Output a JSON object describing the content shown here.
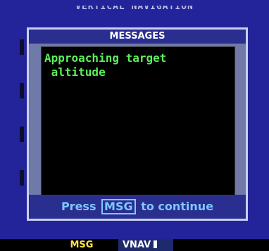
{
  "page": {
    "title": "VERTICAL NAVIGATION"
  },
  "message_window": {
    "header": "MESSAGES",
    "body": "Approaching target\n altitude",
    "footer_prefix": "Press",
    "footer_key": "MSG",
    "footer_suffix": "to continue"
  },
  "softkeys": {
    "msg": "MSG",
    "vnav": "VNAV"
  },
  "colors": {
    "screen_background": "#23239a",
    "message_text": "#5cf05c",
    "footer_text": "#7ec8ff",
    "softkey_msg": "#ffe14a"
  }
}
